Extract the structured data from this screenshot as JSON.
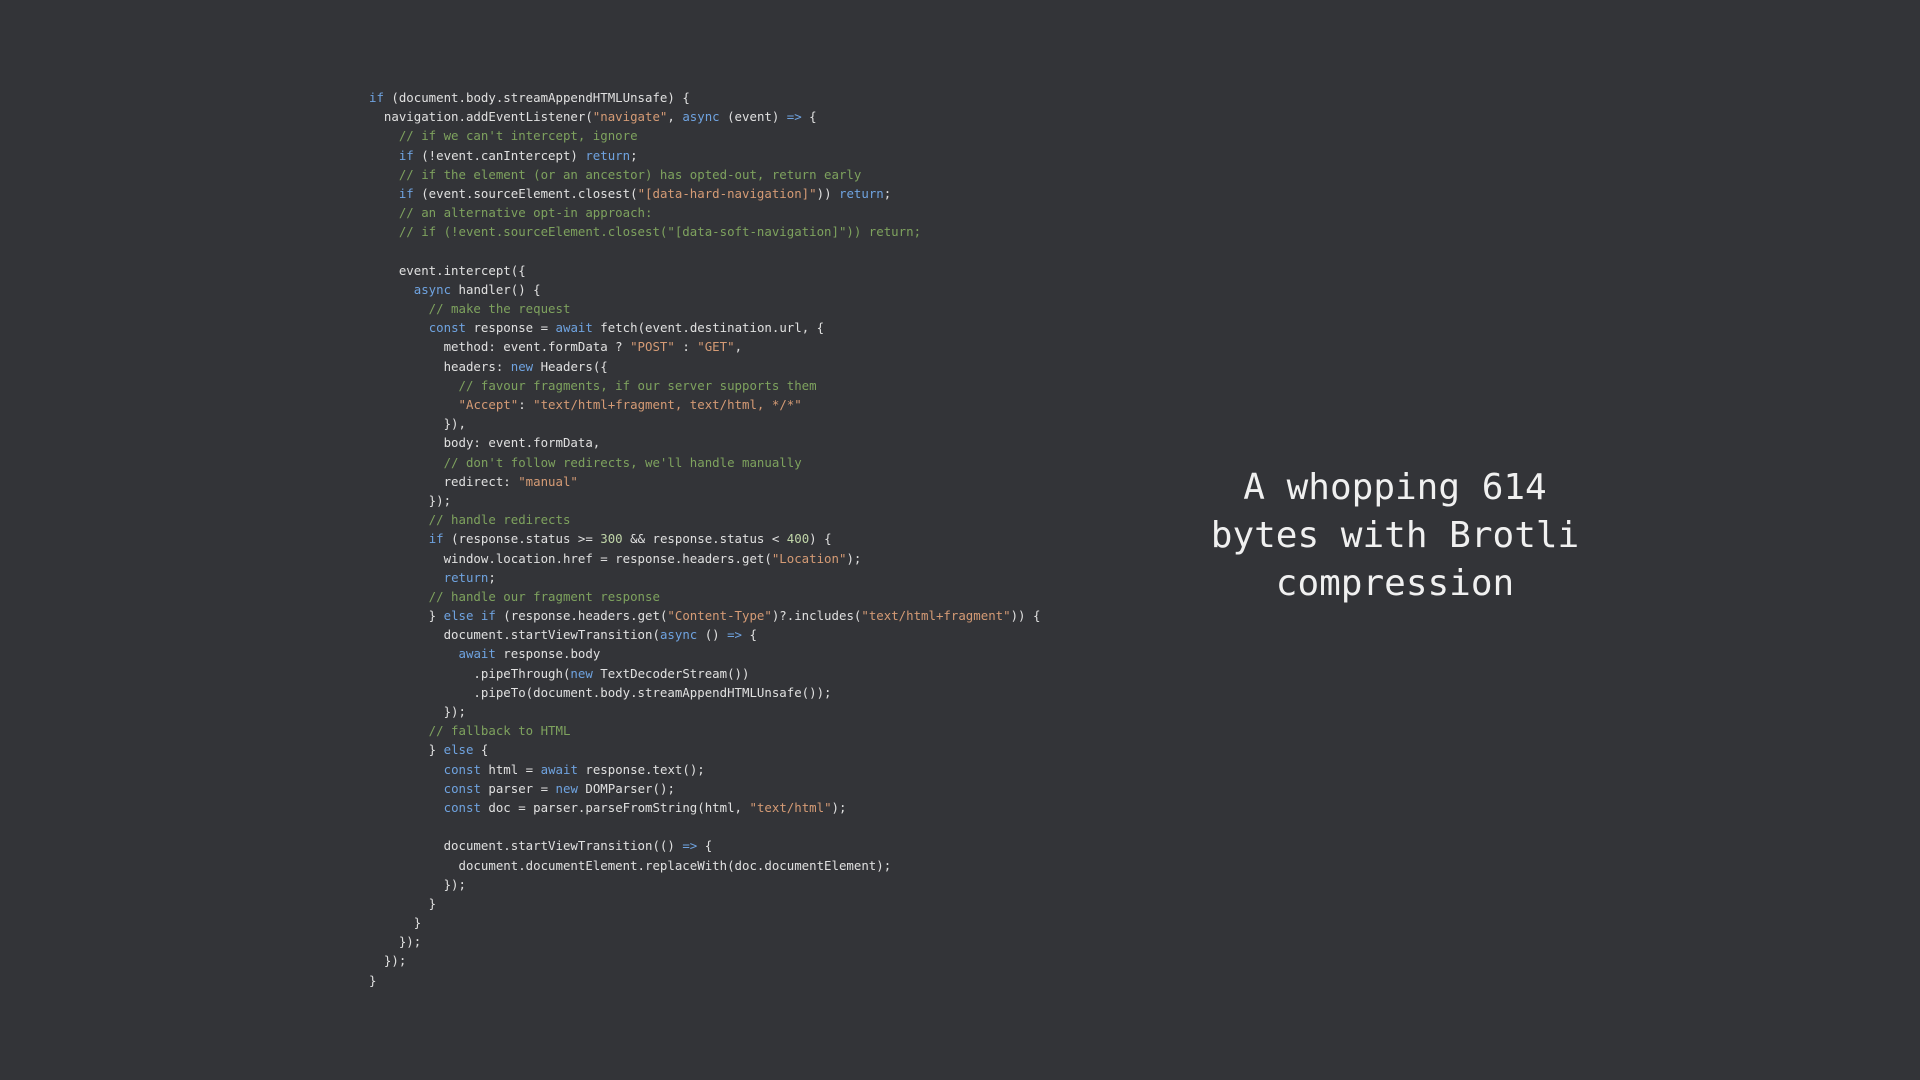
{
  "colors": {
    "background": "#333438",
    "keyword": "#6fa3e0",
    "string": "#d59b75",
    "comment": "#7ea25e",
    "number": "#c0d5a8",
    "plain": "#e0e0e0",
    "caption": "#f0f0f0"
  },
  "code": {
    "lines": [
      [
        {
          "t": "kw",
          "v": "if"
        },
        {
          "t": "plain",
          "v": " (document.body.streamAppendHTMLUnsafe) {"
        }
      ],
      [
        {
          "t": "plain",
          "v": "  navigation.addEventListener("
        },
        {
          "t": "str",
          "v": "\"navigate\""
        },
        {
          "t": "plain",
          "v": ", "
        },
        {
          "t": "kw",
          "v": "async"
        },
        {
          "t": "plain",
          "v": " (event) "
        },
        {
          "t": "kw",
          "v": "=>"
        },
        {
          "t": "plain",
          "v": " {"
        }
      ],
      [
        {
          "t": "com",
          "v": "    // if we can't intercept, ignore"
        }
      ],
      [
        {
          "t": "plain",
          "v": "    "
        },
        {
          "t": "kw",
          "v": "if"
        },
        {
          "t": "plain",
          "v": " (!event.canIntercept) "
        },
        {
          "t": "kw",
          "v": "return"
        },
        {
          "t": "plain",
          "v": ";"
        }
      ],
      [
        {
          "t": "com",
          "v": "    // if the element (or an ancestor) has opted-out, return early"
        }
      ],
      [
        {
          "t": "plain",
          "v": "    "
        },
        {
          "t": "kw",
          "v": "if"
        },
        {
          "t": "plain",
          "v": " (event.sourceElement.closest("
        },
        {
          "t": "str",
          "v": "\"[data-hard-navigation]\""
        },
        {
          "t": "plain",
          "v": ")) "
        },
        {
          "t": "kw",
          "v": "return"
        },
        {
          "t": "plain",
          "v": ";"
        }
      ],
      [
        {
          "t": "com",
          "v": "    // an alternative opt-in approach:"
        }
      ],
      [
        {
          "t": "com",
          "v": "    // if (!event.sourceElement.closest(\"[data-soft-navigation]\")) return;"
        }
      ],
      [
        {
          "t": "plain",
          "v": ""
        }
      ],
      [
        {
          "t": "plain",
          "v": "    event.intercept({"
        }
      ],
      [
        {
          "t": "plain",
          "v": "      "
        },
        {
          "t": "kw",
          "v": "async"
        },
        {
          "t": "plain",
          "v": " handler() {"
        }
      ],
      [
        {
          "t": "com",
          "v": "        // make the request"
        }
      ],
      [
        {
          "t": "plain",
          "v": "        "
        },
        {
          "t": "kw",
          "v": "const"
        },
        {
          "t": "plain",
          "v": " response = "
        },
        {
          "t": "kw",
          "v": "await"
        },
        {
          "t": "plain",
          "v": " fetch(event.destination.url, {"
        }
      ],
      [
        {
          "t": "plain",
          "v": "          method: event.formData ? "
        },
        {
          "t": "str",
          "v": "\"POST\""
        },
        {
          "t": "plain",
          "v": " : "
        },
        {
          "t": "str",
          "v": "\"GET\""
        },
        {
          "t": "plain",
          "v": ","
        }
      ],
      [
        {
          "t": "plain",
          "v": "          headers: "
        },
        {
          "t": "kw",
          "v": "new"
        },
        {
          "t": "plain",
          "v": " Headers({"
        }
      ],
      [
        {
          "t": "com",
          "v": "            // favour fragments, if our server supports them"
        }
      ],
      [
        {
          "t": "plain",
          "v": "            "
        },
        {
          "t": "str",
          "v": "\"Accept\""
        },
        {
          "t": "plain",
          "v": ": "
        },
        {
          "t": "str",
          "v": "\"text/html+fragment, text/html, */*\""
        }
      ],
      [
        {
          "t": "plain",
          "v": "          }),"
        }
      ],
      [
        {
          "t": "plain",
          "v": "          body: event.formData,"
        }
      ],
      [
        {
          "t": "com",
          "v": "          // don't follow redirects, we'll handle manually"
        }
      ],
      [
        {
          "t": "plain",
          "v": "          redirect: "
        },
        {
          "t": "str",
          "v": "\"manual\""
        }
      ],
      [
        {
          "t": "plain",
          "v": "        });"
        }
      ],
      [
        {
          "t": "com",
          "v": "        // handle redirects"
        }
      ],
      [
        {
          "t": "plain",
          "v": "        "
        },
        {
          "t": "kw",
          "v": "if"
        },
        {
          "t": "plain",
          "v": " (response.status >= "
        },
        {
          "t": "num",
          "v": "300"
        },
        {
          "t": "plain",
          "v": " && response.status < "
        },
        {
          "t": "num",
          "v": "400"
        },
        {
          "t": "plain",
          "v": ") {"
        }
      ],
      [
        {
          "t": "plain",
          "v": "          window.location.href = response.headers.get("
        },
        {
          "t": "str",
          "v": "\"Location\""
        },
        {
          "t": "plain",
          "v": ");"
        }
      ],
      [
        {
          "t": "plain",
          "v": "          "
        },
        {
          "t": "kw",
          "v": "return"
        },
        {
          "t": "plain",
          "v": ";"
        }
      ],
      [
        {
          "t": "com",
          "v": "        // handle our fragment response"
        }
      ],
      [
        {
          "t": "plain",
          "v": "        } "
        },
        {
          "t": "kw",
          "v": "else if"
        },
        {
          "t": "plain",
          "v": " (response.headers.get("
        },
        {
          "t": "str",
          "v": "\"Content-Type\""
        },
        {
          "t": "plain",
          "v": ")?.includes("
        },
        {
          "t": "str",
          "v": "\"text/html+fragment\""
        },
        {
          "t": "plain",
          "v": ")) {"
        }
      ],
      [
        {
          "t": "plain",
          "v": "          document.startViewTransition("
        },
        {
          "t": "kw",
          "v": "async"
        },
        {
          "t": "plain",
          "v": " () "
        },
        {
          "t": "kw",
          "v": "=>"
        },
        {
          "t": "plain",
          "v": " {"
        }
      ],
      [
        {
          "t": "plain",
          "v": "            "
        },
        {
          "t": "kw",
          "v": "await"
        },
        {
          "t": "plain",
          "v": " response.body"
        }
      ],
      [
        {
          "t": "plain",
          "v": "              .pipeThrough("
        },
        {
          "t": "kw",
          "v": "new"
        },
        {
          "t": "plain",
          "v": " TextDecoderStream())"
        }
      ],
      [
        {
          "t": "plain",
          "v": "              .pipeTo(document.body.streamAppendHTMLUnsafe());"
        }
      ],
      [
        {
          "t": "plain",
          "v": "          });"
        }
      ],
      [
        {
          "t": "com",
          "v": "        // fallback to HTML"
        }
      ],
      [
        {
          "t": "plain",
          "v": "        } "
        },
        {
          "t": "kw",
          "v": "else"
        },
        {
          "t": "plain",
          "v": " {"
        }
      ],
      [
        {
          "t": "plain",
          "v": "          "
        },
        {
          "t": "kw",
          "v": "const"
        },
        {
          "t": "plain",
          "v": " html = "
        },
        {
          "t": "kw",
          "v": "await"
        },
        {
          "t": "plain",
          "v": " response.text();"
        }
      ],
      [
        {
          "t": "plain",
          "v": "          "
        },
        {
          "t": "kw",
          "v": "const"
        },
        {
          "t": "plain",
          "v": " parser = "
        },
        {
          "t": "kw",
          "v": "new"
        },
        {
          "t": "plain",
          "v": " DOMParser();"
        }
      ],
      [
        {
          "t": "plain",
          "v": "          "
        },
        {
          "t": "kw",
          "v": "const"
        },
        {
          "t": "plain",
          "v": " doc = parser.parseFromString(html, "
        },
        {
          "t": "str",
          "v": "\"text/html\""
        },
        {
          "t": "plain",
          "v": ");"
        }
      ],
      [
        {
          "t": "plain",
          "v": ""
        }
      ],
      [
        {
          "t": "plain",
          "v": "          document.startViewTransition(() "
        },
        {
          "t": "kw",
          "v": "=>"
        },
        {
          "t": "plain",
          "v": " {"
        }
      ],
      [
        {
          "t": "plain",
          "v": "            document.documentElement.replaceWith(doc.documentElement);"
        }
      ],
      [
        {
          "t": "plain",
          "v": "          });"
        }
      ],
      [
        {
          "t": "plain",
          "v": "        }"
        }
      ],
      [
        {
          "t": "plain",
          "v": "      }"
        }
      ],
      [
        {
          "t": "plain",
          "v": "    });"
        }
      ],
      [
        {
          "t": "plain",
          "v": "  });"
        }
      ],
      [
        {
          "t": "plain",
          "v": "}"
        }
      ]
    ]
  },
  "caption": {
    "lines": [
      "A whopping 614",
      "bytes with Brotli",
      "compression"
    ]
  }
}
